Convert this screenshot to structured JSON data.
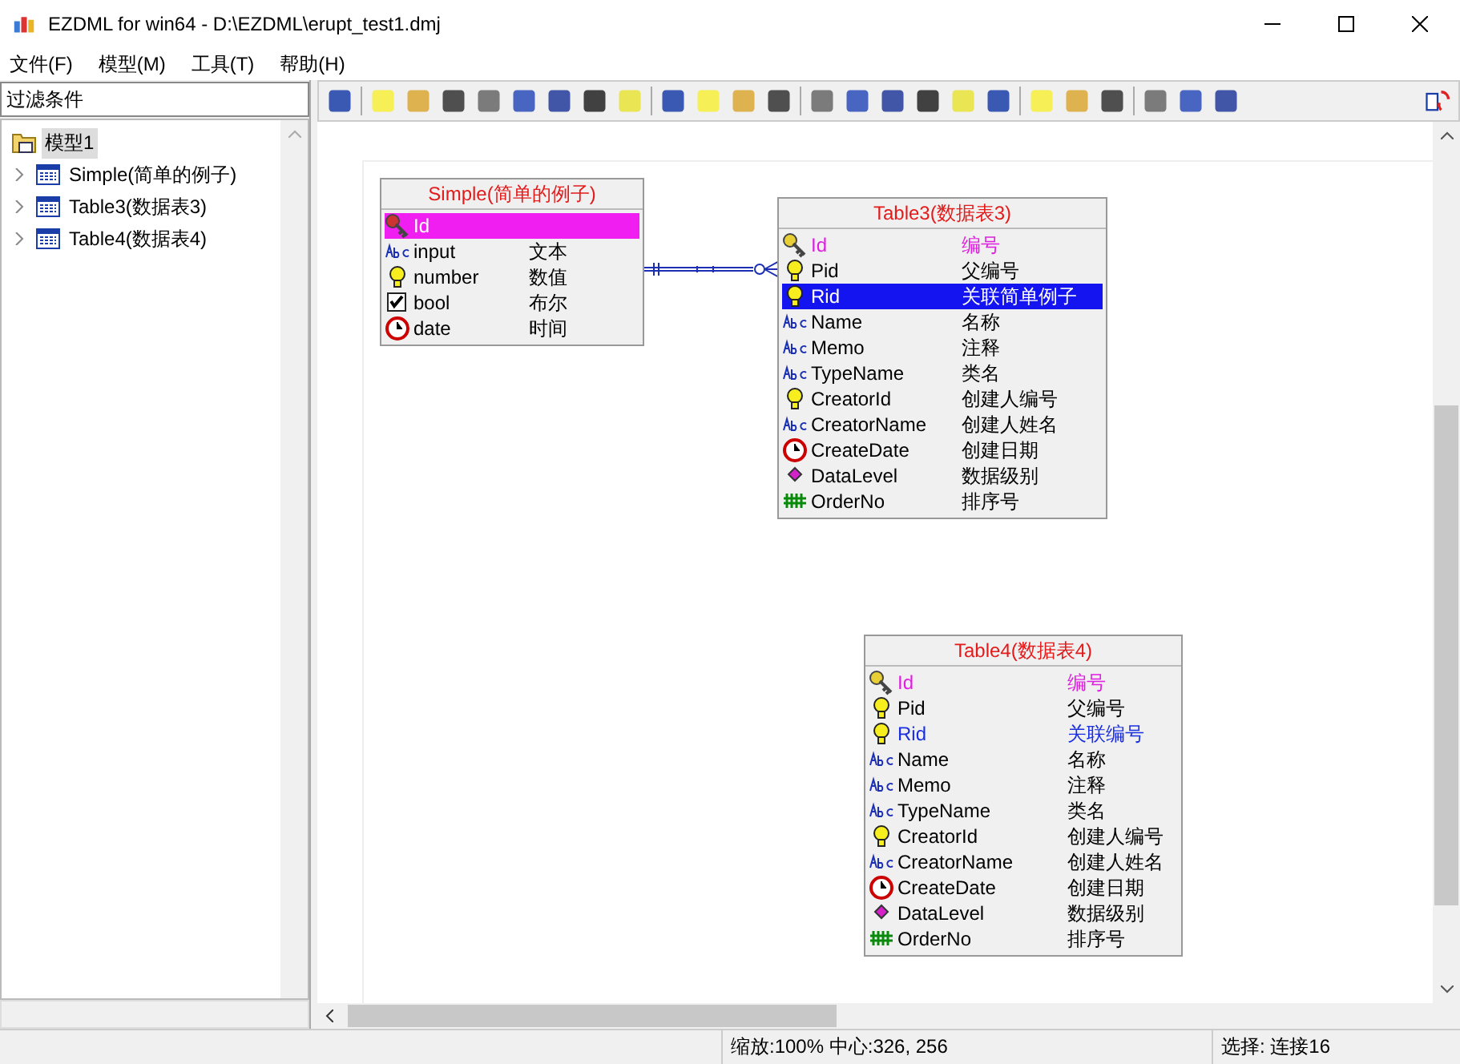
{
  "window": {
    "title": "EZDML for win64 - D:\\EZDML\\erupt_test1.dmj"
  },
  "menu": [
    "文件(F)",
    "模型(M)",
    "工具(T)",
    "帮助(H)"
  ],
  "filter": {
    "placeholder": "过滤条件"
  },
  "tree": [
    {
      "label": "模型1",
      "selected": true,
      "children": [
        {
          "label": "Simple(简单的例子)",
          "selected": false,
          "expanded": false
        },
        {
          "label": "Table3(数据表3)",
          "selected": false,
          "expanded": false
        },
        {
          "label": "Table4(数据表4)",
          "selected": false,
          "expanded": false
        }
      ]
    }
  ],
  "tables": [
    {
      "title": "Simple(简单的例子)",
      "fields": [
        {
          "name": "Id",
          "kind": "primary",
          "selected": true
        },
        {
          "name": "input",
          "comment": "文本",
          "kind": "text",
          "selected": false
        },
        {
          "name": "number",
          "comment": "数值",
          "kind": "number",
          "selected": false
        },
        {
          "name": "bool",
          "comment": "布尔",
          "kind": "bool",
          "selected": false
        },
        {
          "name": "date",
          "comment": "时间",
          "kind": "date",
          "selected": false
        }
      ]
    },
    {
      "title": "Table3(数据表3)",
      "fields": [
        {
          "name": "Id",
          "comment": "编号",
          "kind": "primary",
          "selected": false
        },
        {
          "name": "Pid",
          "comment": "父编号",
          "kind": "number",
          "selected": false
        },
        {
          "name": "Rid",
          "comment": "关联简单例子",
          "kind": "foreign",
          "selected": true
        },
        {
          "name": "Name",
          "comment": "名称",
          "kind": "text",
          "selected": false
        },
        {
          "name": "Memo",
          "comment": "注释",
          "kind": "text",
          "selected": false
        },
        {
          "name": "TypeName",
          "comment": "类名",
          "kind": "text",
          "selected": false
        },
        {
          "name": "CreatorId",
          "comment": "创建人编号",
          "kind": "number",
          "selected": false
        },
        {
          "name": "CreatorName",
          "comment": "创建人姓名",
          "kind": "text",
          "selected": false
        },
        {
          "name": "CreateDate",
          "comment": "创建日期",
          "kind": "date",
          "selected": false
        },
        {
          "name": "DataLevel",
          "comment": "数据级别",
          "kind": "enum",
          "selected": false
        },
        {
          "name": "OrderNo",
          "comment": "排序号",
          "kind": "serial",
          "selected": false
        }
      ]
    },
    {
      "title": "Table4(数据表4)",
      "fields": [
        {
          "name": "Id",
          "comment": "编号",
          "kind": "primary",
          "selected": false
        },
        {
          "name": "Pid",
          "comment": "父编号",
          "kind": "number",
          "selected": false
        },
        {
          "name": "Rid",
          "comment": "关联编号",
          "kind": "foreign",
          "selected": false
        },
        {
          "name": "Name",
          "comment": "名称",
          "kind": "text",
          "selected": false
        },
        {
          "name": "Memo",
          "comment": "注释",
          "kind": "text",
          "selected": false
        },
        {
          "name": "TypeName",
          "comment": "类名",
          "kind": "text",
          "selected": false
        },
        {
          "name": "CreatorId",
          "comment": "创建人编号",
          "kind": "number",
          "selected": false
        },
        {
          "name": "CreatorName",
          "comment": "创建人姓名",
          "kind": "text",
          "selected": false
        },
        {
          "name": "CreateDate",
          "comment": "创建日期",
          "kind": "date",
          "selected": false
        },
        {
          "name": "DataLevel",
          "comment": "数据级别",
          "kind": "enum",
          "selected": false
        },
        {
          "name": "OrderNo",
          "comment": "排序号",
          "kind": "serial",
          "selected": false
        }
      ]
    }
  ],
  "status_bar": {
    "zoom_center": "缩放:100% 中心:326, 256",
    "selection": "选择: 连接16"
  }
}
